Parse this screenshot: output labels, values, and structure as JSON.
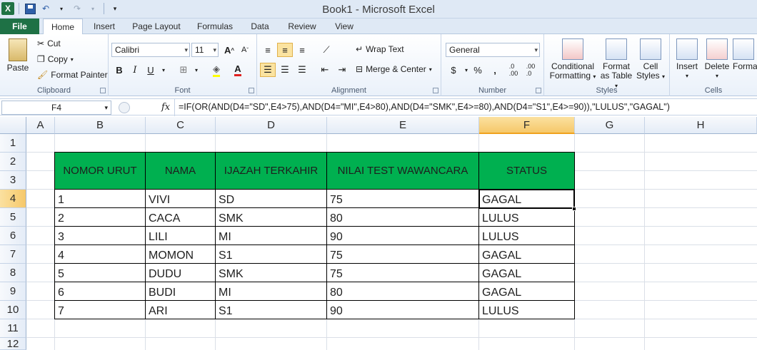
{
  "window": {
    "title": "Book1  -  Microsoft Excel",
    "logo": "X"
  },
  "tabs": [
    "File",
    "Home",
    "Insert",
    "Page Layout",
    "Formulas",
    "Data",
    "Review",
    "View"
  ],
  "clipboard": {
    "paste": "Paste",
    "cut": "Cut",
    "copy": "Copy",
    "format_painter": "Format Painter",
    "label": "Clipboard"
  },
  "font": {
    "name": "Calibri",
    "size": "11",
    "label": "Font"
  },
  "alignment": {
    "wrap_text": "Wrap Text",
    "merge_center": "Merge & Center",
    "label": "Alignment"
  },
  "number": {
    "format": "General",
    "label": "Number"
  },
  "styles": {
    "conditional": [
      "Conditional",
      "Formatting"
    ],
    "format_table": [
      "Format",
      "as Table"
    ],
    "cell_styles": [
      "Cell",
      "Styles"
    ],
    "label": "Styles"
  },
  "cells": {
    "insert": "Insert",
    "delete": "Delete",
    "format": "Forma",
    "label": "Cells"
  },
  "formula_bar": {
    "name_box": "F4",
    "fx": "fx",
    "formula": "=IF(OR(AND(D4=\"SD\",E4>75),AND(D4=\"MI\",E4>80),AND(D4=\"SMK\",E4>=80),AND(D4=\"S1\",E4>=90)),\"LULUS\",\"GAGAL\")"
  },
  "columns": [
    "A",
    "B",
    "C",
    "D",
    "E",
    "F",
    "G",
    "H"
  ],
  "rows": [
    "1",
    "2",
    "3",
    "4",
    "5",
    "6",
    "7",
    "8",
    "9",
    "10",
    "11",
    "12"
  ],
  "table": {
    "headers": [
      "NOMOR URUT",
      "NAMA",
      "IJAZAH TERKAHIR",
      "NILAI TEST WAWANCARA",
      "STATUS"
    ],
    "rows": [
      [
        "1",
        "VIVI",
        "SD",
        "75",
        "GAGAL"
      ],
      [
        "2",
        "CACA",
        "SMK",
        "80",
        "LULUS"
      ],
      [
        "3",
        "LILI",
        "MI",
        "90",
        "LULUS"
      ],
      [
        "4",
        "MOMON",
        "S1",
        "75",
        "GAGAL"
      ],
      [
        "5",
        "DUDU",
        "SMK",
        "75",
        "GAGAL"
      ],
      [
        "6",
        "BUDI",
        "MI",
        "80",
        "GAGAL"
      ],
      [
        "7",
        "ARI",
        "S1",
        "90",
        "LULUS"
      ]
    ]
  },
  "colors": {
    "header_fill": "#00b050",
    "file_tab": "#1e7145",
    "selection": "#f6c86a"
  }
}
